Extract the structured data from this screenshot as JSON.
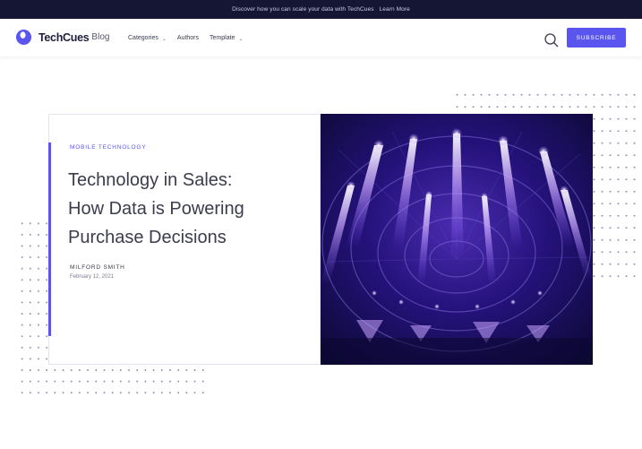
{
  "topbar": {
    "message": "Discover how you can scale your data with TechCues",
    "link": "Learn More"
  },
  "header": {
    "brand": "TechCues",
    "brand_sub": "Blog",
    "nav": [
      {
        "label": "Categories",
        "has_dropdown": true
      },
      {
        "label": "Authors",
        "has_dropdown": false
      },
      {
        "label": "Template",
        "has_dropdown": true
      }
    ],
    "subscribe_label": "SUBSCRIBE"
  },
  "article": {
    "category": "MOBILE TECHNOLOGY",
    "title_lines": [
      "Technology in Sales:",
      "How Data is Powering",
      "Purchase Decisions"
    ],
    "author": "MILFORD SMITH",
    "date": "February 12, 2021"
  },
  "colors": {
    "accent": "#5b55f0",
    "topbar_bg": "#151634",
    "hero_dark": "#0e0a3a",
    "hero_glow": "#b98cff"
  },
  "icons": {
    "logo": "techcues-logo-icon",
    "search": "search-icon",
    "chevron": "chevron-down-icon"
  }
}
